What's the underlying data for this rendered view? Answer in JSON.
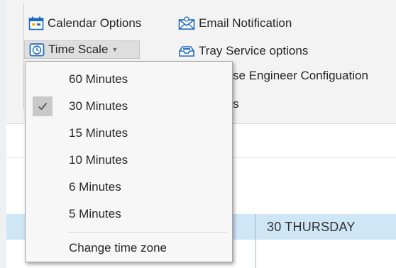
{
  "ribbon": {
    "calendar_options": "Calendar Options",
    "email_notification": "Email Notification",
    "time_scale": "Time Scale",
    "tray_service_options": "Tray Service options",
    "partial_engineer_config": "se Engineer Configuation",
    "partial_settings": "s"
  },
  "time_scale_menu": {
    "items": [
      {
        "label": "60 Minutes",
        "checked": false
      },
      {
        "label": "30 Minutes",
        "checked": true
      },
      {
        "label": "15 Minutes",
        "checked": false
      },
      {
        "label": "10 Minutes",
        "checked": false
      },
      {
        "label": "6 Minutes",
        "checked": false
      },
      {
        "label": "5 Minutes",
        "checked": false
      }
    ],
    "change_time_zone": "Change time zone",
    "check_glyph": "✓"
  },
  "calendar": {
    "day_header": "30 THURSDAY"
  },
  "colors": {
    "accent": "#1f6bbf",
    "selected_day_row": "#cfe6f7",
    "checkbox_bg": "#c9c9c9"
  },
  "icons": {
    "calendar_options": "calendar-icon",
    "email_notification": "envelope-icon",
    "time_scale": "clock-icon",
    "tray_service_options": "tray-icon",
    "checked": "checkmark-icon"
  }
}
